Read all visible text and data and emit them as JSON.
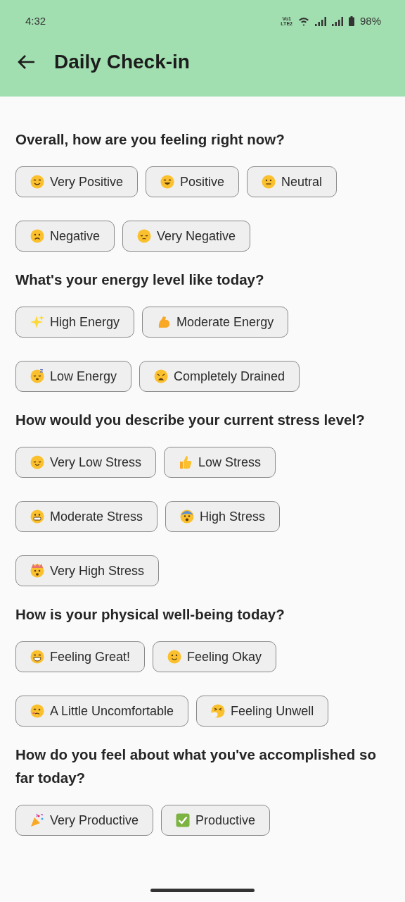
{
  "status_bar": {
    "time": "4:32",
    "network_top": "Vo1",
    "network_bottom": "LTE2",
    "battery": "98%"
  },
  "app_bar": {
    "title": "Daily Check-in"
  },
  "questions": [
    {
      "text": "Overall, how are you feeling right now?",
      "options": [
        {
          "label": "Very Positive",
          "selected": false
        },
        {
          "label": "Positive",
          "selected": false
        },
        {
          "label": "Neutral",
          "selected": false
        },
        {
          "label": "Negative",
          "selected": false
        },
        {
          "label": "Very Negative",
          "selected": false
        }
      ]
    },
    {
      "text": "What's your energy level like today?",
      "options": [
        {
          "label": "High Energy",
          "selected": false
        },
        {
          "label": "Moderate Energy",
          "selected": false
        },
        {
          "label": "Low Energy",
          "selected": false
        },
        {
          "label": "Completely Drained",
          "selected": false
        }
      ]
    },
    {
      "text": "How would you describe your current stress level?",
      "options": [
        {
          "label": "Very Low Stress",
          "selected": false
        },
        {
          "label": "Low Stress",
          "selected": false
        },
        {
          "label": "Moderate Stress",
          "selected": false
        },
        {
          "label": "High Stress",
          "selected": false
        },
        {
          "label": "Very High Stress",
          "selected": false
        }
      ]
    },
    {
      "text": "How is your physical well-being today?",
      "options": [
        {
          "label": "Feeling Great!",
          "selected": false
        },
        {
          "label": "Feeling Okay",
          "selected": false
        },
        {
          "label": "A Little Uncomfortable",
          "selected": false
        },
        {
          "label": "Feeling Unwell",
          "selected": false
        }
      ]
    },
    {
      "text": "How do you feel about what you've accomplished so far today?",
      "options": [
        {
          "label": "Very Productive",
          "selected": false
        },
        {
          "label": "Productive",
          "selected": false
        }
      ]
    }
  ]
}
